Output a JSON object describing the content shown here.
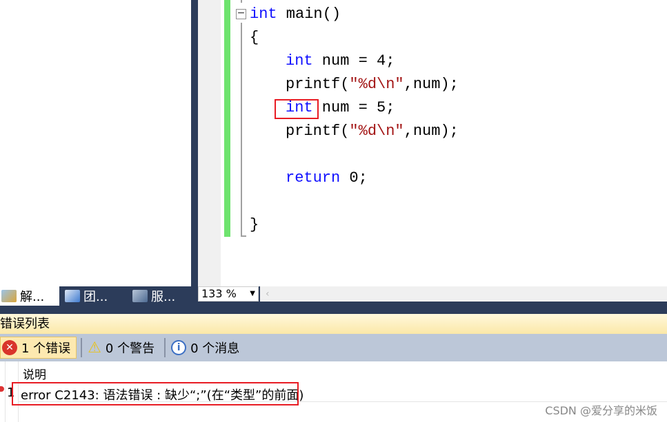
{
  "editor": {
    "lines": [
      {
        "parts": [
          {
            "t": "int",
            "k": "kw"
          },
          {
            "t": " main()"
          }
        ]
      },
      {
        "parts": [
          {
            "t": "{"
          }
        ]
      },
      {
        "parts": [
          {
            "t": "int",
            "k": "kw"
          },
          {
            "t": " num = 4;"
          }
        ]
      },
      {
        "parts": [
          {
            "t": "printf("
          },
          {
            "t": "\"%d\\n\"",
            "k": "str"
          },
          {
            "t": ",num);"
          }
        ]
      },
      {
        "parts": [
          {
            "t": "int",
            "k": "kw"
          },
          {
            "t": " num = 5;"
          }
        ]
      },
      {
        "parts": [
          {
            "t": "printf("
          },
          {
            "t": "\"%d\\n\"",
            "k": "str"
          },
          {
            "t": ",num);"
          }
        ]
      },
      {
        "parts": []
      },
      {
        "parts": [
          {
            "t": "return",
            "k": "kw"
          },
          {
            "t": " 0;"
          }
        ]
      },
      {
        "parts": []
      },
      {
        "parts": [
          {
            "t": "}"
          }
        ]
      }
    ],
    "zoom": "133 %"
  },
  "tabs": [
    {
      "label": "解...",
      "icon": "solution-explorer-icon"
    },
    {
      "label": "团...",
      "icon": "team-explorer-icon"
    },
    {
      "label": "服...",
      "icon": "server-explorer-icon"
    }
  ],
  "error_list": {
    "title": "错误列表",
    "errors_btn": "1 个错误",
    "warnings_btn": "0 个警告",
    "messages_btn": "0 个消息",
    "column": "说明",
    "rows": [
      {
        "num": "1",
        "description": "error C2143: 语法错误 : 缺少“;”(在“类型”的前面)"
      }
    ]
  },
  "watermark": "CSDN @爱分享的米饭",
  "colors": {
    "keyword": "#1010ff",
    "string": "#a31515",
    "highlight": "#e81b23",
    "frame": "#2c3c5a"
  }
}
